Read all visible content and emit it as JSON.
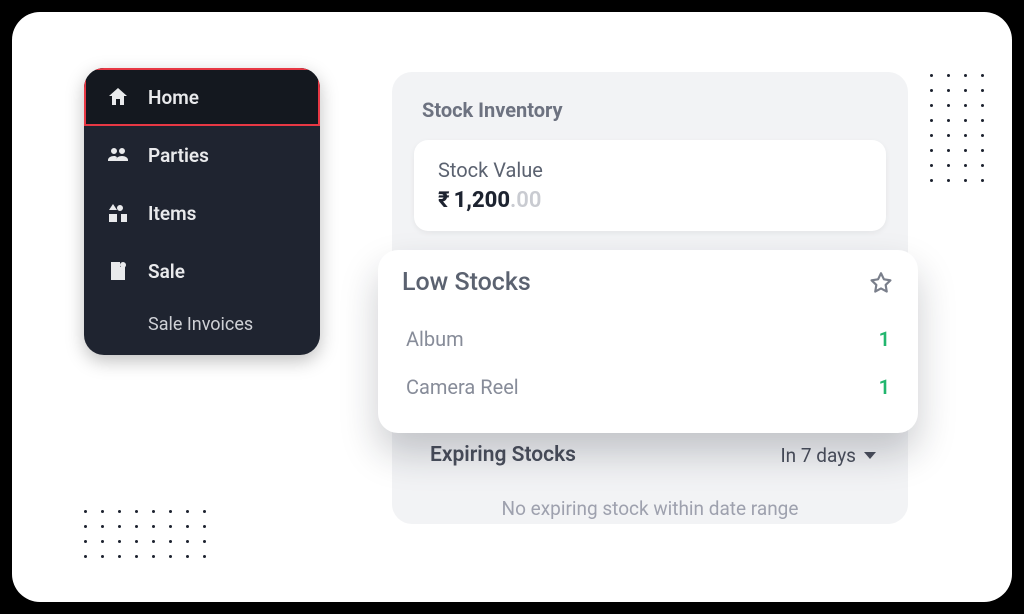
{
  "sidebar": {
    "items": [
      {
        "label": "Home"
      },
      {
        "label": "Parties"
      },
      {
        "label": "Items"
      },
      {
        "label": "Sale"
      }
    ],
    "sub": {
      "label": "Sale Invoices"
    }
  },
  "stock_inventory": {
    "title": "Stock Inventory",
    "value_label": "Stock Value",
    "currency_symbol": "₹",
    "amount_int": "1,200",
    "amount_dec": ".00"
  },
  "low_stocks": {
    "title": "Low Stocks",
    "items": [
      {
        "name": "Album",
        "qty": "1"
      },
      {
        "name": "Camera Reel",
        "qty": "1"
      }
    ]
  },
  "expiring": {
    "title": "Expiring Stocks",
    "filter_label": "In 7 days",
    "empty_text": "No expiring stock within date range"
  },
  "colors": {
    "active_border": "#e73844",
    "qty_green": "#22b66e"
  }
}
